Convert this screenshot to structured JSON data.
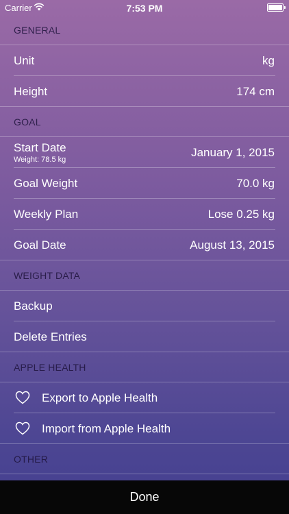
{
  "status_bar": {
    "carrier": "Carrier",
    "time": "7:53 PM",
    "wifi_icon": "wifi-icon",
    "battery_icon": "battery-icon"
  },
  "sections": {
    "general": {
      "header": "GENERAL",
      "unit": {
        "label": "Unit",
        "value": "kg"
      },
      "height": {
        "label": "Height",
        "value": "174 cm"
      }
    },
    "goal": {
      "header": "GOAL",
      "start_date": {
        "label": "Start Date",
        "sub": "Weight: 78.5 kg",
        "value": "January 1, 2015"
      },
      "goal_weight": {
        "label": "Goal Weight",
        "value": "70.0 kg"
      },
      "weekly_plan": {
        "label": "Weekly Plan",
        "value": "Lose 0.25 kg"
      },
      "goal_date": {
        "label": "Goal Date",
        "value": "August 13, 2015"
      }
    },
    "weight_data": {
      "header": "WEIGHT DATA",
      "backup": {
        "label": "Backup"
      },
      "delete_entries": {
        "label": "Delete Entries"
      }
    },
    "apple_health": {
      "header": "APPLE HEALTH",
      "export": {
        "label": "Export to Apple Health",
        "icon": "heart-icon"
      },
      "import": {
        "label": "Import from Apple Health",
        "icon": "heart-icon"
      }
    },
    "other": {
      "header": "OTHER"
    }
  },
  "done_button": {
    "label": "Done"
  },
  "colors": {
    "background_top": "#9a6aa6",
    "background_bottom": "#433f8f",
    "header_text": "#1e143c",
    "done_bar": "#070707"
  }
}
